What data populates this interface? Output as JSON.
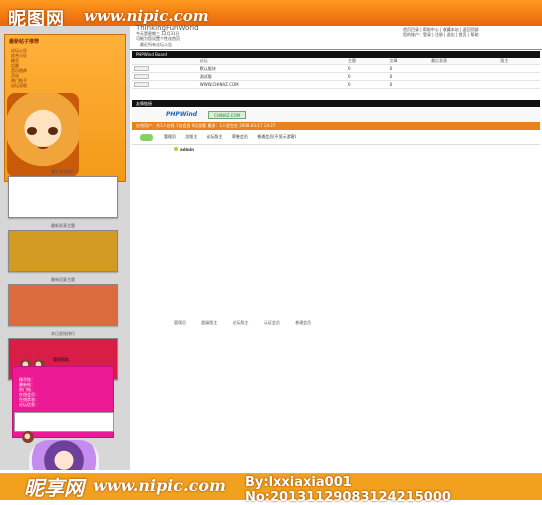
{
  "watermarks": {
    "top_cn": "昵图网",
    "top_url": "www.nipic.com",
    "bottom_cn": "昵享网",
    "bottom_url": "www.nipic.com",
    "bottom_meta": "By:lxxiaxia001 No:20131129083124215000"
  },
  "header": {
    "title_tag": "ThinkingFunWorld",
    "meta_left": [
      "今天是星期三 12月31日",
      "可能为您设置个性化首页"
    ],
    "meta_right": [
      "首页目录 | 帮助中心 | 收藏本站 | 返回顶部",
      "您的账户：登录 | 注册 | 退出 | 首页 | 帮助"
    ]
  },
  "sidebar": {
    "section_title": "最新帖子推荐",
    "links": [
      "论坛公告",
      "综合讨论",
      "精华",
      "话题",
      "音乐图库",
      "活动",
      "热门帖子",
      "论坛导航"
    ],
    "widgets": [
      {
        "label": "最新发表图片",
        "box": "white"
      },
      {
        "label": "最新发表主题",
        "box": "gold"
      },
      {
        "label": "最新回复主题",
        "box": "orange"
      },
      {
        "label": "本日发帖排行",
        "box": "red"
      }
    ],
    "pink_title": "管理帮助",
    "pink_items": [
      "精华帖：",
      "最新帖：",
      "热门帖：",
      "在线会员：",
      "在线状态：",
      "论坛信息："
    ]
  },
  "main": {
    "notice": "最近所有论坛公告",
    "bar1": "PHPWind Board",
    "table_headers": [
      "",
      "论坛",
      "主题",
      "文章",
      "最后发表",
      "版主"
    ],
    "boards": [
      {
        "name": "默认版块",
        "topics": "0",
        "posts": "0"
      },
      {
        "name": "测试版",
        "topics": "0",
        "posts": "0"
      },
      {
        "name": "WWW.CHINAZ.COM",
        "topics": "0",
        "posts": "0"
      }
    ],
    "bar2": "友情链接",
    "logos": [
      "PHPWind",
      "CHINAZ.COM"
    ],
    "online_text": "在线用户：共1人在线 1位会员 0位游客 最多：1人发生在 2008-03-17 14:27",
    "legend": [
      "管理员",
      "总版主",
      "论坛版主",
      "荣誉会员",
      "普通会员(不显示游客)"
    ],
    "member": "admin",
    "bottom_links": [
      "管理员",
      "超级版主",
      "论坛版主",
      "认证会员",
      "普通会员"
    ]
  }
}
